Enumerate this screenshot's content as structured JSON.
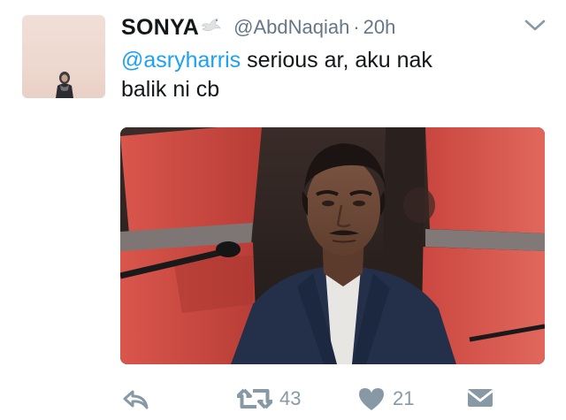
{
  "tweet": {
    "display_name": "SONYA",
    "handle": "@AbdNaqiah",
    "separator": "·",
    "time": "20h",
    "mention": "@asryharris",
    "text_line1_rest": " serious ar, aku nak",
    "text_line2": "balik ni cb"
  },
  "actions": {
    "retweet_count": "43",
    "like_count": "21"
  },
  "icons": {
    "reply": "reply-icon",
    "retweet": "retweet-icon",
    "like": "heart-icon",
    "dm": "envelope-icon",
    "caret": "chevron-down-icon",
    "emoji": "dove-icon"
  },
  "colors": {
    "link": "#1da1f2",
    "muted": "#657786",
    "action": "#8899a6"
  }
}
